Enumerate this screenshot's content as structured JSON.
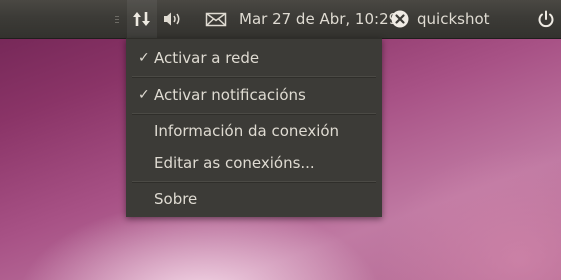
{
  "panel": {
    "network_icon": "network-updown-icon",
    "volume_icon": "speaker-volume-icon",
    "mail_icon": "envelope-icon",
    "clock": "Mar 27 de Abr, 10:29",
    "user_icon": "user-status-icon",
    "username": "quickshot",
    "power_icon": "power-icon"
  },
  "network_menu": {
    "items": [
      {
        "label": "Activar a rede",
        "checked": "✓"
      },
      {
        "label": "Activar notificacións",
        "checked": "✓"
      },
      {
        "label": "Información da conexión",
        "checked": ""
      },
      {
        "label": "Editar as conexións...",
        "checked": ""
      },
      {
        "label": "Sobre",
        "checked": ""
      }
    ]
  },
  "colors": {
    "panel_bg": "#3c3b37",
    "panel_text": "#dfdbd2",
    "menu_bg": "#3c3b37",
    "desktop_primary": "#a85286"
  }
}
